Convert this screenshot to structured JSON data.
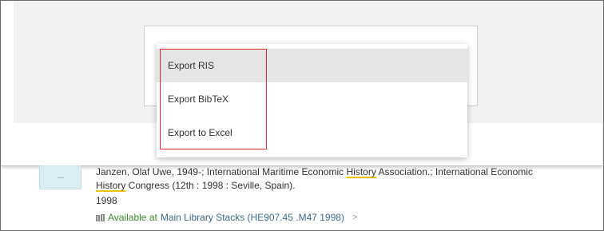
{
  "export_menu": {
    "items": [
      {
        "label": "Export RIS",
        "highlighted": true
      },
      {
        "label": "Export BibTeX",
        "highlighted": false
      },
      {
        "label": "Export to Excel",
        "highlighted": false
      }
    ]
  },
  "record": {
    "authors_part1": "Janzen, Olaf Uwe, 1949-; International Maritime Economic ",
    "history_word_1": "History",
    "authors_part2": " Association.; International Economic",
    "history_word_2": "History",
    "authors_part3": " Congress (12th : 1998 : Seville, Spain).",
    "year": "1998",
    "availability_status": "Available at",
    "availability_location": "Main Library  Stacks (HE907.45 .M47 1998)",
    "chevron": ">"
  },
  "colors": {
    "highlight_box": "#e02b2b",
    "available_green": "#3a8d2d",
    "location_blue": "#3d6a8f",
    "search_term_underline": "#f2c200"
  },
  "icons": {
    "availability": "book-icon",
    "more": "chevron-right-icon"
  }
}
